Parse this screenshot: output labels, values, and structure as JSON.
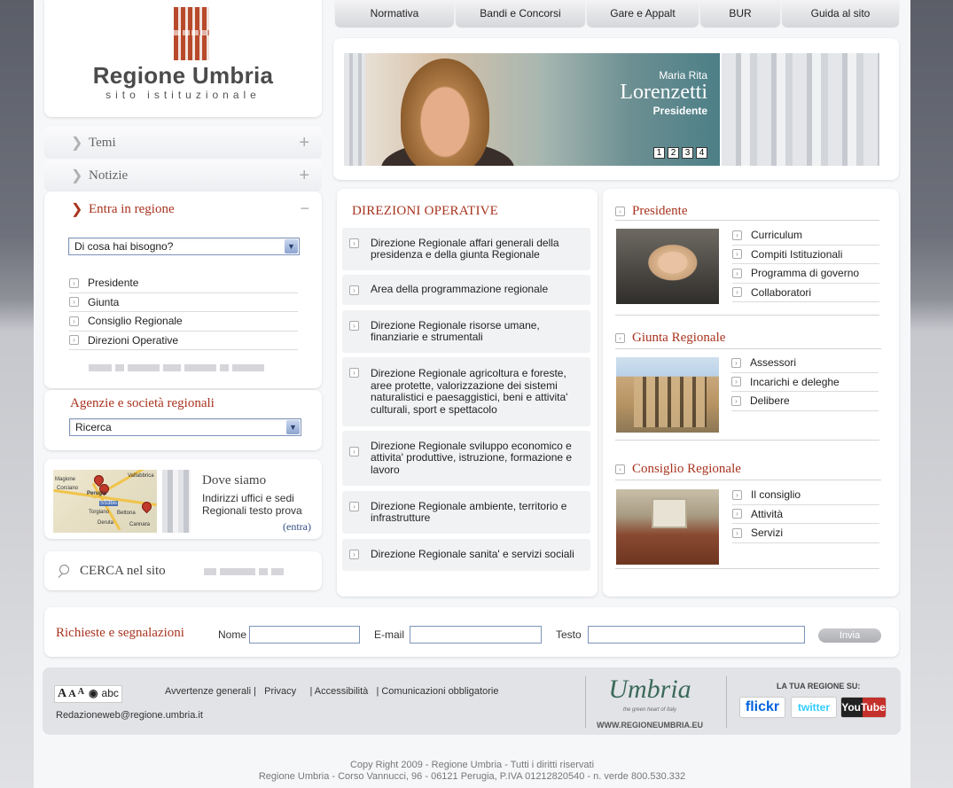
{
  "colors": {
    "accent": "#a8331f",
    "link": "#334f85"
  },
  "logo": {
    "title": "Regione Umbria",
    "subtitle": "sito istituzionale"
  },
  "topnav": [
    {
      "label": "Normativa"
    },
    {
      "label": "Bandi e Concorsi"
    },
    {
      "label": "Gare e Appalt"
    },
    {
      "label": "BUR"
    },
    {
      "label": "Guida al sito"
    }
  ],
  "sidebar": {
    "temi": "Temi",
    "notizie": "Notizie",
    "entra": "Entra in regione",
    "need_select": "Di cosa hai bisogno?",
    "links": [
      "Presidente",
      "Giunta",
      "Consiglio Regionale",
      "Direzioni Operative"
    ],
    "agenzie_title": "Agenzie e società regionali",
    "agenzie_select": "Ricerca"
  },
  "banner": {
    "first_name": "Maria Rita",
    "last_name": "Lorenzetti",
    "role": "Presidente",
    "pages": [
      "1",
      "2",
      "3",
      "4"
    ]
  },
  "direzioni": {
    "title": "DIREZIONI OPERATIVE",
    "items": [
      "Direzione Regionale affari generali della presidenza e della giunta Regionale",
      "Area della programmazione regionale",
      "Direzione Regionale risorse umane, finanziarie e strumentali",
      "Direzione Regionale agricoltura e foreste, aree protette, valorizzazione dei sistemi naturalistici e paesaggistici, beni e attivita' culturali, sport e spettacolo",
      "Direzione Regionale sviluppo economico e attivita' produttive, istruzione, formazione e lavoro",
      "Direzione Regionale ambiente, territorio e infrastrutture",
      "Direzione Regionale sanita' e servizi sociali"
    ]
  },
  "right": {
    "presidente": {
      "title": "Presidente",
      "links": [
        "Curriculum",
        "Compiti Istituzionali",
        "Programma di governo",
        "Collaboratori"
      ]
    },
    "giunta": {
      "title": "Giunta Regionale",
      "links": [
        "Assessori",
        "Incarichi e deleghe",
        "Delibere"
      ]
    },
    "consiglio": {
      "title": "Consiglio Regionale",
      "links": [
        "Il consiglio",
        "Attività",
        "Servizi"
      ]
    }
  },
  "dove": {
    "title": "Dove siamo",
    "text": "Indirizzi uffici e sedi Regionali testo prova",
    "link": "(entra)",
    "map_labels": [
      "Magione",
      "Corciano",
      "Perugia",
      "Torgiano",
      "Bettona",
      "Deruta",
      "Cannara",
      "SS3bis",
      "Valfabbrica"
    ]
  },
  "cerca": {
    "label": "CERCA  nel sito"
  },
  "richieste": {
    "title": "Richieste e segnalazioni",
    "nome": "Nome",
    "email": "E-mail",
    "testo": "Testo",
    "invia": "Invia"
  },
  "footer": {
    "font_sizes": [
      "A",
      "A",
      "A"
    ],
    "contrast": "abc",
    "links": [
      "Avvertenze generali |",
      "Privacy",
      "| Accessibilità",
      "| Comunicazioni obbligatorie"
    ],
    "email": "Redazioneweb@regione.umbria.it",
    "umbria_logo": "Umbria",
    "umbria_tag": "the green heart of Italy",
    "umbria_url": "WWW.REGIONEUMBRIA.EU",
    "social_label": "LA TUA REGIONE SU:",
    "social": [
      "flickr",
      "twitter",
      "YouTube"
    ]
  },
  "copyright": {
    "line1": "Copy Right 2009 - Regione Umbria - Tutti i diritti riservati",
    "line2": "Regione Umbria - Corso Vannucci, 96 - 06121 Perugia, P.IVA 01212820540 - n. verde 800.530.332"
  }
}
